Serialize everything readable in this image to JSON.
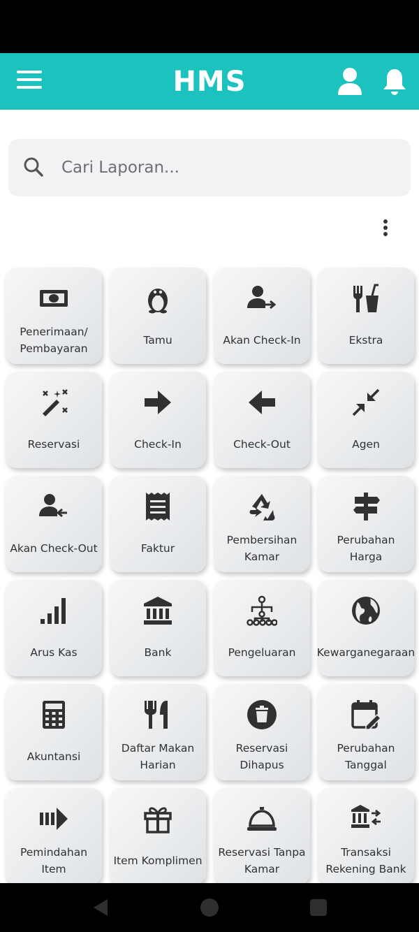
{
  "app": {
    "title": "HMS"
  },
  "search": {
    "placeholder": "Cari Laporan..."
  },
  "menu": [
    {
      "label": "Penerimaan/ Pembayaran",
      "icon": "money-icon"
    },
    {
      "label": "Tamu",
      "icon": "penguin-icon"
    },
    {
      "label": "Akan Check-In",
      "icon": "person-arrow-right-icon"
    },
    {
      "label": "Ekstra",
      "icon": "food-drink-icon"
    },
    {
      "label": "Reservasi",
      "icon": "magic-wand-icon"
    },
    {
      "label": "Check-In",
      "icon": "arrow-right-icon"
    },
    {
      "label": "Check-Out",
      "icon": "arrow-left-icon"
    },
    {
      "label": "Agen",
      "icon": "compress-arrows-icon"
    },
    {
      "label": "Akan Check-Out",
      "icon": "person-arrow-left-icon"
    },
    {
      "label": "Faktur",
      "icon": "receipt-icon"
    },
    {
      "label": "Pembersihan Kamar",
      "icon": "recycle-icon"
    },
    {
      "label": "Perubahan Harga",
      "icon": "signpost-icon"
    },
    {
      "label": "Arus Kas",
      "icon": "signal-bars-icon"
    },
    {
      "label": "Bank",
      "icon": "bank-icon"
    },
    {
      "label": "Pengeluaran",
      "icon": "sitemap-icon"
    },
    {
      "label": "Kewarganegaraan",
      "icon": "globe-icon"
    },
    {
      "label": "Akuntansi",
      "icon": "calculator-icon"
    },
    {
      "label": "Daftar Makan Harian",
      "icon": "utensils-icon"
    },
    {
      "label": "Reservasi Dihapus",
      "icon": "trash-circle-icon"
    },
    {
      "label": "Perubahan Tanggal",
      "icon": "calendar-edit-icon"
    },
    {
      "label": "Pemindahan Item",
      "icon": "move-items-icon"
    },
    {
      "label": "Item Komplimen",
      "icon": "gift-icon"
    },
    {
      "label": "Reservasi Tanpa Kamar",
      "icon": "room-service-icon"
    },
    {
      "label": "Transaksi Rekening Bank",
      "icon": "bank-transfer-icon"
    }
  ],
  "colors": {
    "app_bar": "#1cc2bd",
    "icon": "#2f3133",
    "tile_light": "#f6f7f8",
    "tile_dark": "#dfe2e5"
  }
}
